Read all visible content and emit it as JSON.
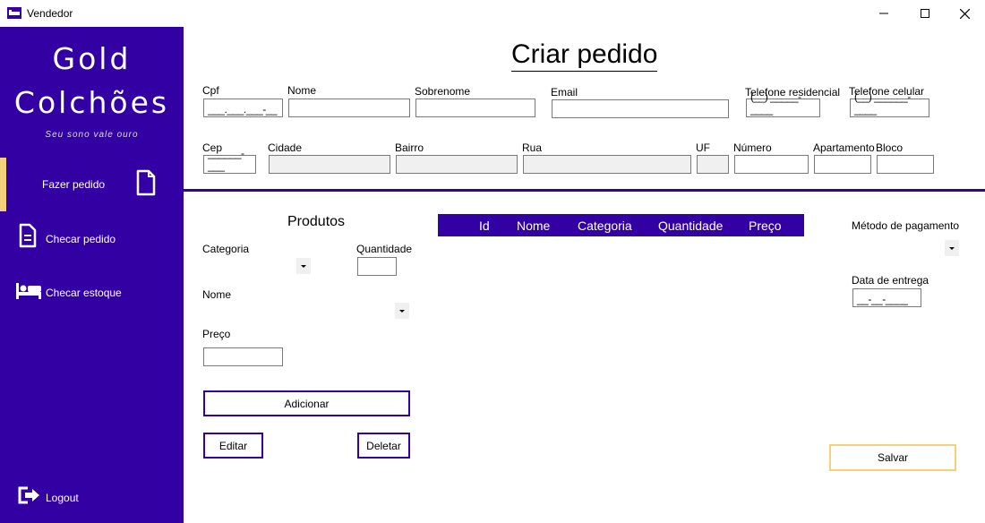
{
  "window": {
    "title": "Vendedor"
  },
  "sidebar": {
    "brand_line1": "Gold",
    "brand_line2": "Colchões",
    "slogan": "Seu sono vale ouro",
    "items": [
      {
        "label": "Fazer pedido",
        "icon": "document-icon",
        "active": true
      },
      {
        "label": "Checar pedido",
        "icon": "document-lines-icon",
        "active": false
      },
      {
        "label": "Checar estoque",
        "icon": "bed-icon",
        "active": false
      }
    ],
    "logout_label": "Logout"
  },
  "header": {
    "title": "Criar pedido"
  },
  "customer": {
    "cpf_label": "Cpf",
    "cpf_mask": "___.___.___-__",
    "nome_label": "Nome",
    "sobrenome_label": "Sobrenome",
    "email_label": "Email",
    "tel_res_label": "Telefone residencial",
    "tel_res_mask": "(__) _____-____",
    "tel_cel_label": "Telefone celular",
    "tel_cel_mask": "(__) ______-____",
    "cep_label": "Cep",
    "cep_mask": "______-___",
    "cidade_label": "Cidade",
    "bairro_label": "Bairro",
    "rua_label": "Rua",
    "uf_label": "UF",
    "numero_label": "Número",
    "apartamento_label": "Apartamento",
    "bloco_label": "Bloco"
  },
  "products": {
    "title": "Produtos",
    "categoria_label": "Categoria",
    "quantidade_label": "Quantidade",
    "nome_label": "Nome",
    "preco_label": "Preço",
    "add_button": "Adicionar",
    "edit_button": "Editar",
    "delete_button": "Deletar"
  },
  "grid": {
    "columns": [
      "Id",
      "Nome",
      "Categoria",
      "Quantidade",
      "Preço"
    ]
  },
  "payment": {
    "method_label": "Método de pagamento",
    "delivery_label": "Data de entrega",
    "delivery_mask": "__-__-____",
    "save_button": "Salvar"
  },
  "colors": {
    "brand": "#3300a3",
    "accent": "#f2d17a"
  }
}
